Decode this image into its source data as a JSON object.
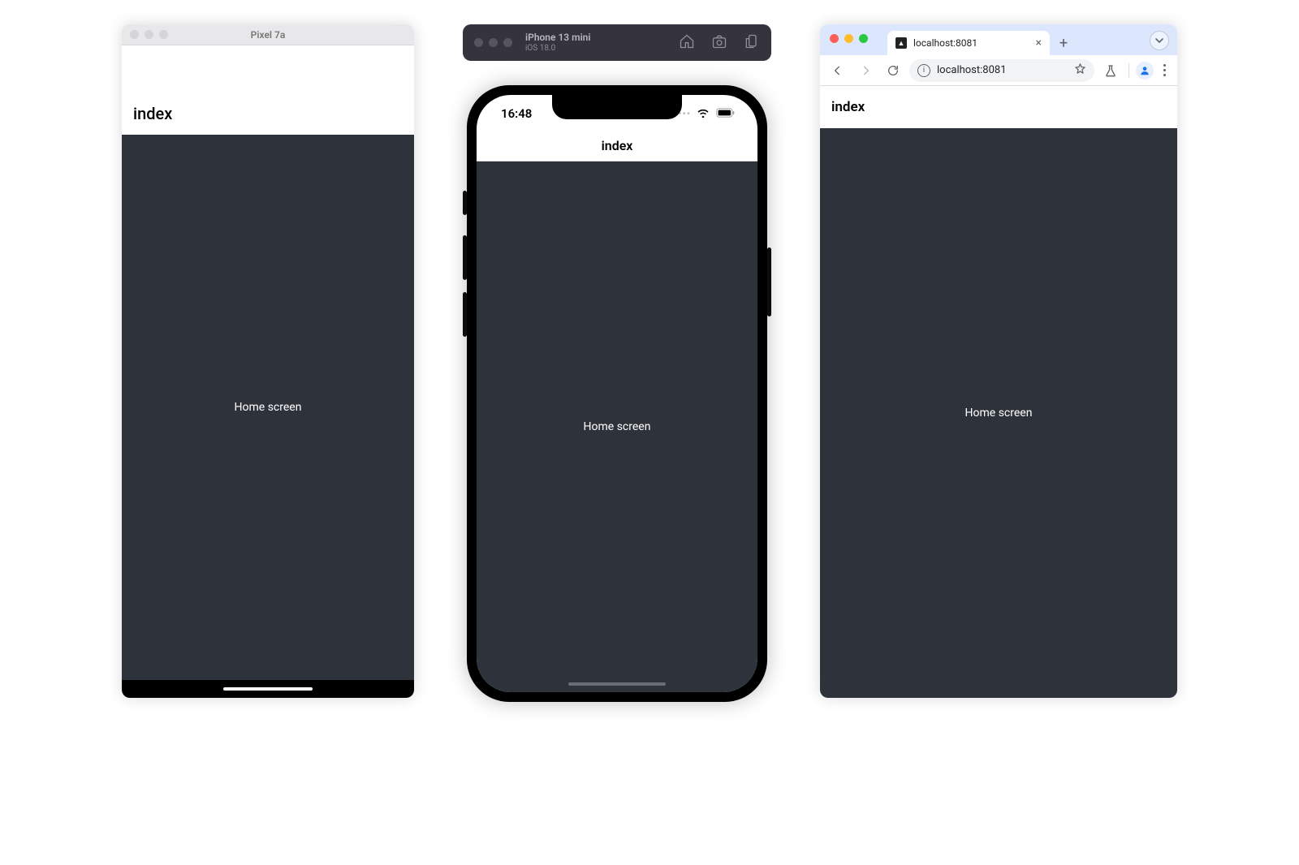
{
  "android": {
    "window_title": "Pixel 7a",
    "app_header": "index",
    "content_text": "Home screen"
  },
  "ios": {
    "window_title": "iPhone 13 mini",
    "os_label": "iOS 18.0",
    "status_time": "16:48",
    "app_header": "index",
    "content_text": "Home screen"
  },
  "browser": {
    "tab_title": "localhost:8081",
    "url_text": "localhost:8081",
    "app_header": "index",
    "content_text": "Home screen"
  }
}
